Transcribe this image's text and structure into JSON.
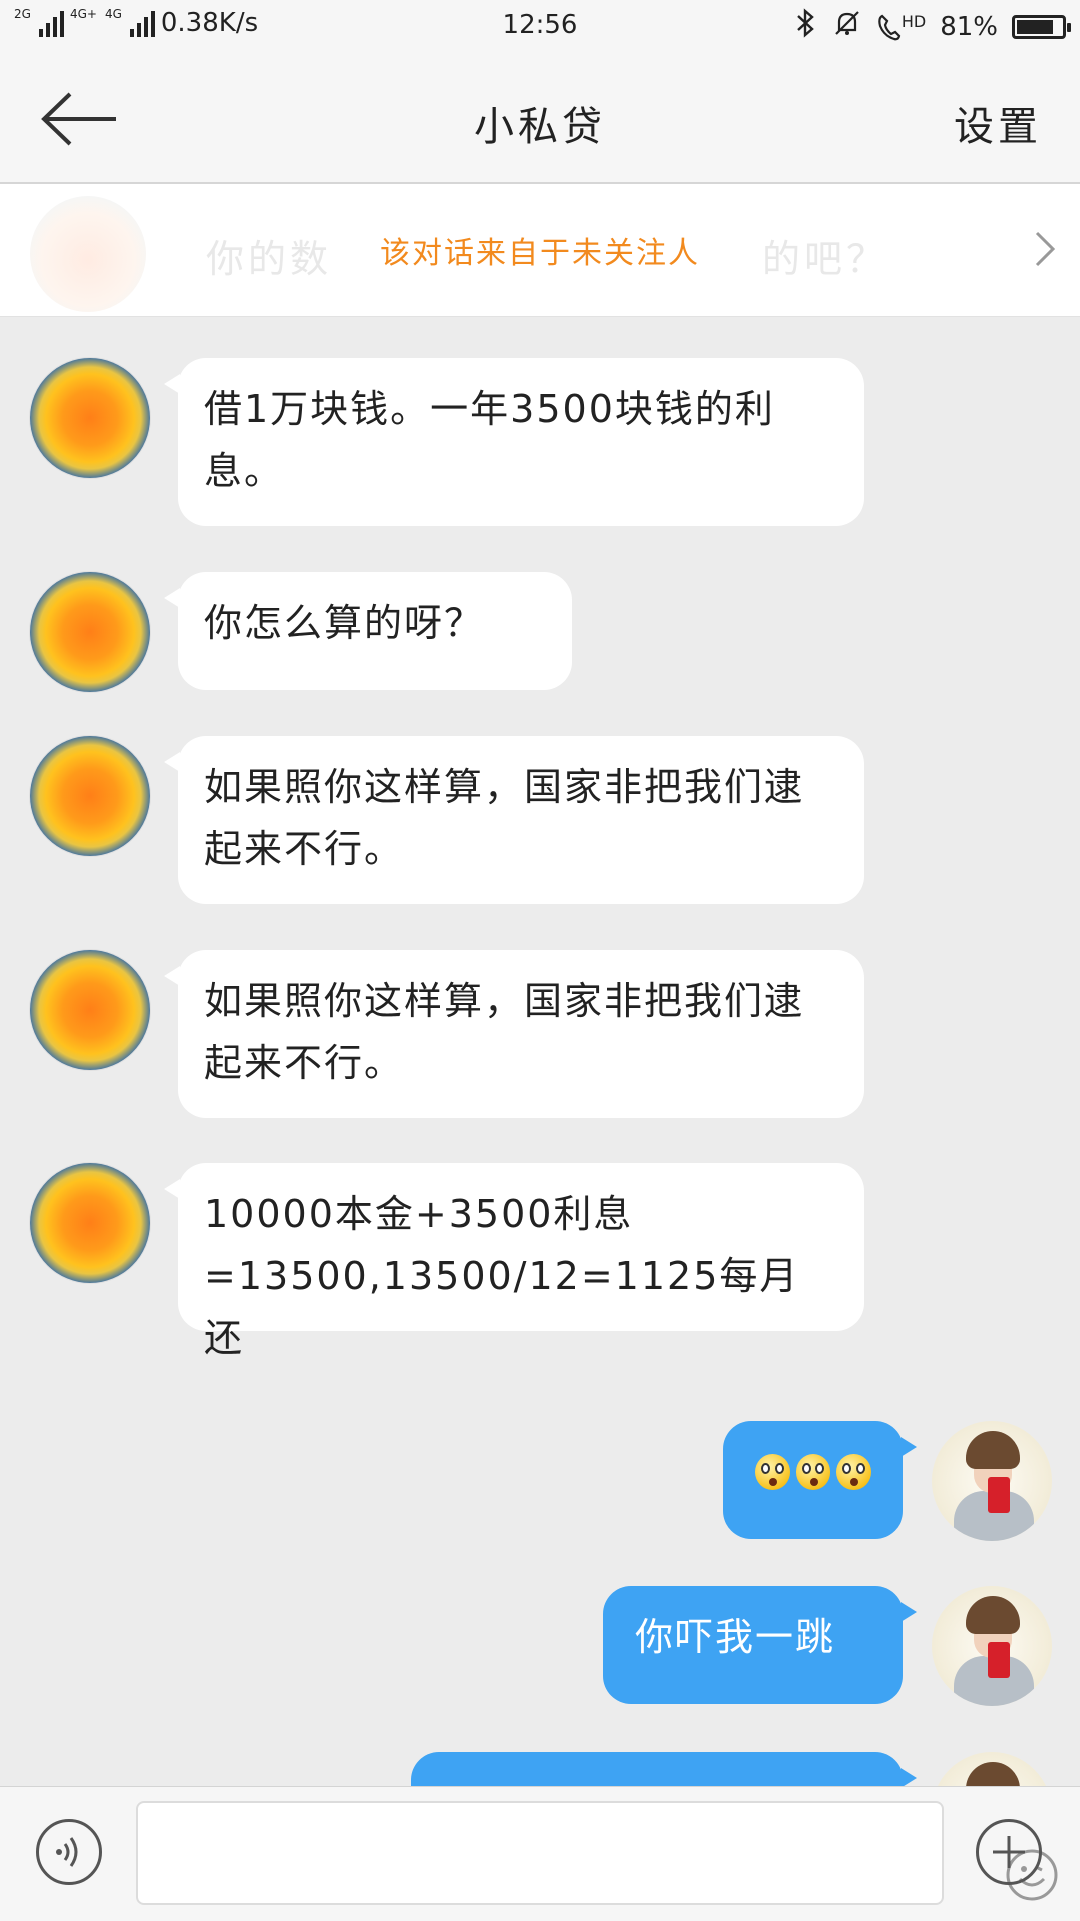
{
  "status_bar": {
    "signal1": "2G",
    "signal2": "4G+",
    "signal3": "4G",
    "net_speed": "0.38K/s",
    "time": "12:56",
    "hd": "HD",
    "battery_pct": "81%",
    "battery_level": 0.81
  },
  "header": {
    "title": "小私贷",
    "settings_label": "设置",
    "back_icon": "back-arrow-icon"
  },
  "notice": {
    "preview": "你的数",
    "preview_tail": "的吧？",
    "text": "该对话来自于未关注人"
  },
  "messages": [
    {
      "side": "left",
      "text": "借1万块钱。一年3500块钱的利息。"
    },
    {
      "side": "left",
      "text": "你怎么算的呀？"
    },
    {
      "side": "left",
      "text": "如果照你这样算，国家非把我们逮起来不行。"
    },
    {
      "side": "left",
      "text": "如果照你这样算，国家非把我们逮起来不行。"
    },
    {
      "side": "left",
      "text": "10000本金+3500利息=13500,13500/12=1125每月还"
    },
    {
      "side": "right",
      "emojis": [
        "astonished-emoji",
        "astonished-emoji",
        "astonished-emoji"
      ]
    },
    {
      "side": "right",
      "text": "你吓我一跳"
    },
    {
      "side": "right",
      "text": ""
    }
  ],
  "input_bar": {
    "voice_icon": "voice-icon",
    "emoji_icon": "smiley-icon",
    "plus_icon": "plus-icon",
    "value": ""
  },
  "colors": {
    "incoming_bubble": "#ffffff",
    "outgoing_bubble": "#3ea3f3",
    "notice_text": "#f28a1e",
    "chat_bg": "#ececec"
  }
}
